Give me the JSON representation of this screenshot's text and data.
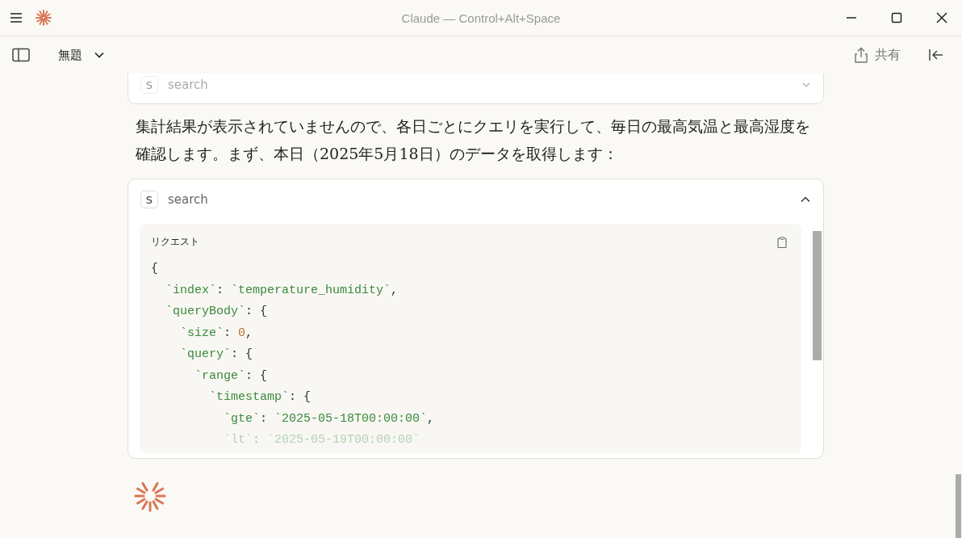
{
  "window": {
    "title": "Claude — Control+Alt+Space"
  },
  "toolbar": {
    "chat_title": "無題",
    "share_label": "共有"
  },
  "previous_tool": {
    "badge": "S",
    "name": "search",
    "expanded": false
  },
  "message": "集計結果が表示されていませんので、各日ごとにクエリを実行して、毎日の最高気温と最高湿度を確認します。まず、本日（2025年5月18日）のデータを取得します：",
  "tool": {
    "badge": "S",
    "name": "search",
    "expanded": true,
    "section_label": "リクエスト",
    "code": [
      [
        {
          "kind": "punct",
          "text": "{"
        }
      ],
      [
        {
          "kind": "key",
          "text": "  `index`"
        },
        {
          "kind": "punct",
          "text": ": "
        },
        {
          "kind": "string",
          "text": "`temperature_humidity`"
        },
        {
          "kind": "punct",
          "text": ","
        }
      ],
      [
        {
          "kind": "key",
          "text": "  `queryBody`"
        },
        {
          "kind": "punct",
          "text": ": {"
        }
      ],
      [
        {
          "kind": "key",
          "text": "    `size`"
        },
        {
          "kind": "punct",
          "text": ": "
        },
        {
          "kind": "number",
          "text": "0"
        },
        {
          "kind": "punct",
          "text": ","
        }
      ],
      [
        {
          "kind": "key",
          "text": "    `query`"
        },
        {
          "kind": "punct",
          "text": ": {"
        }
      ],
      [
        {
          "kind": "key",
          "text": "      `range`"
        },
        {
          "kind": "punct",
          "text": ": {"
        }
      ],
      [
        {
          "kind": "key",
          "text": "        `timestamp`"
        },
        {
          "kind": "punct",
          "text": ": {"
        }
      ],
      [
        {
          "kind": "key",
          "text": "          `gte`"
        },
        {
          "kind": "punct",
          "text": ": "
        },
        {
          "kind": "string",
          "text": "`2025-05-18T00:00:00`"
        },
        {
          "kind": "punct",
          "text": ","
        }
      ],
      [
        {
          "kind": "key",
          "text": "          `lt`"
        },
        {
          "kind": "punct",
          "text": ": "
        },
        {
          "kind": "string",
          "text": "`2025-05-19T00:00:00`"
        }
      ]
    ]
  }
}
